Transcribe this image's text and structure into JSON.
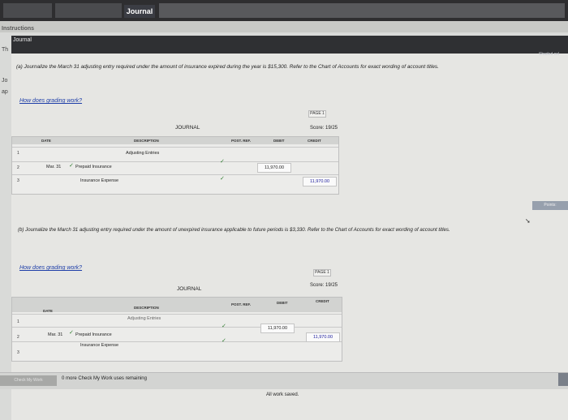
{
  "window": {
    "tab_label": "Journal"
  },
  "instructions_label": "Instructions",
  "panel": {
    "title": "Journal",
    "side_letters": [
      "Th",
      "Jo",
      "ap"
    ],
    "shaded_label": "Shaded cel"
  },
  "part_a": {
    "question": "(a) Journalize the March 31 adjusting entry required under the amount of insurance expired during the year is $15,300. Refer to the Chart of Accounts for exact wording of account titles.",
    "link": "How does grading work?",
    "page": "PAGE 1",
    "score": "Score: 19/25",
    "journal_title": "JOURNAL",
    "headers": {
      "date": "DATE",
      "description": "DESCRIPTION",
      "post_ref": "POST. REF.",
      "debit": "DEBIT",
      "credit": "CREDIT"
    },
    "rows": [
      {
        "num": "1",
        "date": "",
        "description": "Adjusting Entries",
        "debit": "",
        "credit": ""
      },
      {
        "num": "2",
        "date": "Mar. 31",
        "description": "Prepaid Insurance",
        "debit": "11,970.00",
        "credit": ""
      },
      {
        "num": "3",
        "date": "",
        "description": "Insurance Expense",
        "debit": "",
        "credit": "11,970.00"
      }
    ]
  },
  "points_label": "Points:",
  "part_b": {
    "question": "(b) Journalize the March 31 adjusting entry required under the amount of unexpired insurance applicable to future periods is $3,330. Refer to the Chart of Accounts for exact wording of account titles.",
    "link": "How does grading work?",
    "page": "PAGE 1",
    "score": "Score: 19/25",
    "journal_title": "JOURNAL",
    "headers": {
      "date": "DATE",
      "description": "DESCRIPTION",
      "post_ref": "POST. REF.",
      "debit": "DEBIT",
      "credit": "CREDIT"
    },
    "rows": [
      {
        "num": "1",
        "date": "",
        "description": "Adjusting Entries",
        "debit": "",
        "credit": ""
      },
      {
        "num": "2",
        "date": "Mar. 31",
        "description": "Prepaid Insurance",
        "debit": "11,970.00",
        "credit": ""
      },
      {
        "num": "3",
        "date": "",
        "description": "Insurance Expense",
        "debit": "",
        "credit": "11,970.00"
      }
    ]
  },
  "bottom": {
    "check_button": "Check My Work",
    "remaining_note": "0 more Check My Work uses remaining"
  },
  "saved_status": "All work saved."
}
